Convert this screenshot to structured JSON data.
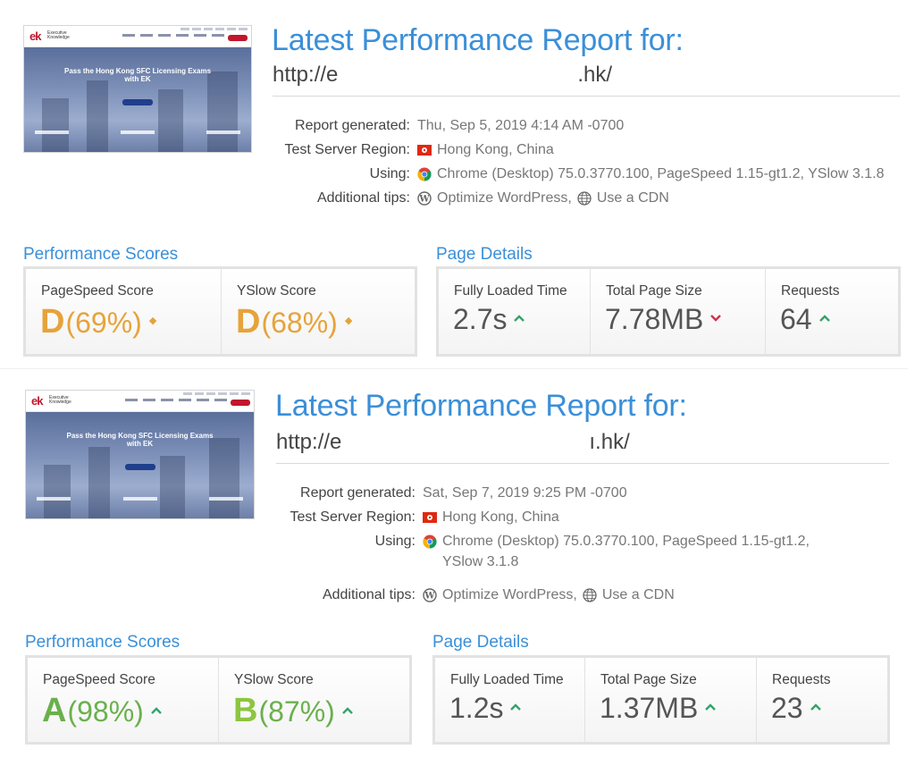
{
  "colors": {
    "accent": "#3b8fd8",
    "grade_d": "#e6a33a",
    "grade_a": "#6ab04c",
    "grade_b": "#8cc63f",
    "up": "#33a36b",
    "down": "#d0334b"
  },
  "reports": [
    {
      "thumbnail": {
        "logo": "ek",
        "logo_sub": "Executive Knowledge",
        "headline": "Pass the Hong Kong SFC Licensing Exams with EK"
      },
      "title": "Latest Performance Report for:",
      "url_start": "http://e",
      "url_end": ".hk/",
      "meta": {
        "report_generated_label": "Report generated:",
        "report_generated": "Thu, Sep 5, 2019 4:14 AM -0700",
        "region_label": "Test Server Region:",
        "region": "Hong Kong, China",
        "using_label": "Using:",
        "using_1": "Chrome (Desktop) 75.0.3770.100, PageSpeed 1.15-gt1.2, YSlow 3.1.8",
        "using_2": "",
        "tips_label": "Additional tips:",
        "tip_wp": "Optimize WordPress,",
        "tip_cdn": "Use a CDN"
      },
      "performance": {
        "title": "Performance Scores",
        "pagespeed_label": "PageSpeed Score",
        "pagespeed_grade": "D",
        "pagespeed_pct": "(69%)",
        "pagespeed_trend": "◆",
        "yslow_label": "YSlow Score",
        "yslow_grade": "D",
        "yslow_pct": "(68%)",
        "yslow_trend": "◆"
      },
      "details": {
        "title": "Page Details",
        "load_label": "Fully Loaded Time",
        "load_value": "2.7s",
        "load_trend": "up",
        "size_label": "Total Page Size",
        "size_value": "7.78MB",
        "size_trend": "down",
        "req_label": "Requests",
        "req_value": "64",
        "req_trend": "up"
      }
    },
    {
      "thumbnail": {
        "logo": "ek",
        "logo_sub": "Executive Knowledge",
        "headline": "Pass the Hong Kong SFC Licensing Exams with EK"
      },
      "title": "Latest Performance Report for:",
      "url_start": "http://e",
      "url_end": "ı.hk/",
      "meta": {
        "report_generated_label": "Report generated:",
        "report_generated": "Sat, Sep 7, 2019 9:25 PM -0700",
        "region_label": "Test Server Region:",
        "region": "Hong Kong, China",
        "using_label": "Using:",
        "using_1": "Chrome (Desktop) 75.0.3770.100, PageSpeed 1.15-gt1.2,",
        "using_2": "YSlow 3.1.8",
        "tips_label": "Additional tips:",
        "tip_wp": "Optimize WordPress,",
        "tip_cdn": "Use a CDN"
      },
      "performance": {
        "title": "Performance Scores",
        "pagespeed_label": "PageSpeed Score",
        "pagespeed_grade": "A",
        "pagespeed_pct": "(98%)",
        "pagespeed_trend": "^",
        "yslow_label": "YSlow Score",
        "yslow_grade": "B",
        "yslow_pct": "(87%)",
        "yslow_trend": "^"
      },
      "details": {
        "title": "Page Details",
        "load_label": "Fully Loaded Time",
        "load_value": "1.2s",
        "load_trend": "up",
        "size_label": "Total Page Size",
        "size_value": "1.37MB",
        "size_trend": "up",
        "req_label": "Requests",
        "req_value": "23",
        "req_trend": "up"
      }
    }
  ]
}
